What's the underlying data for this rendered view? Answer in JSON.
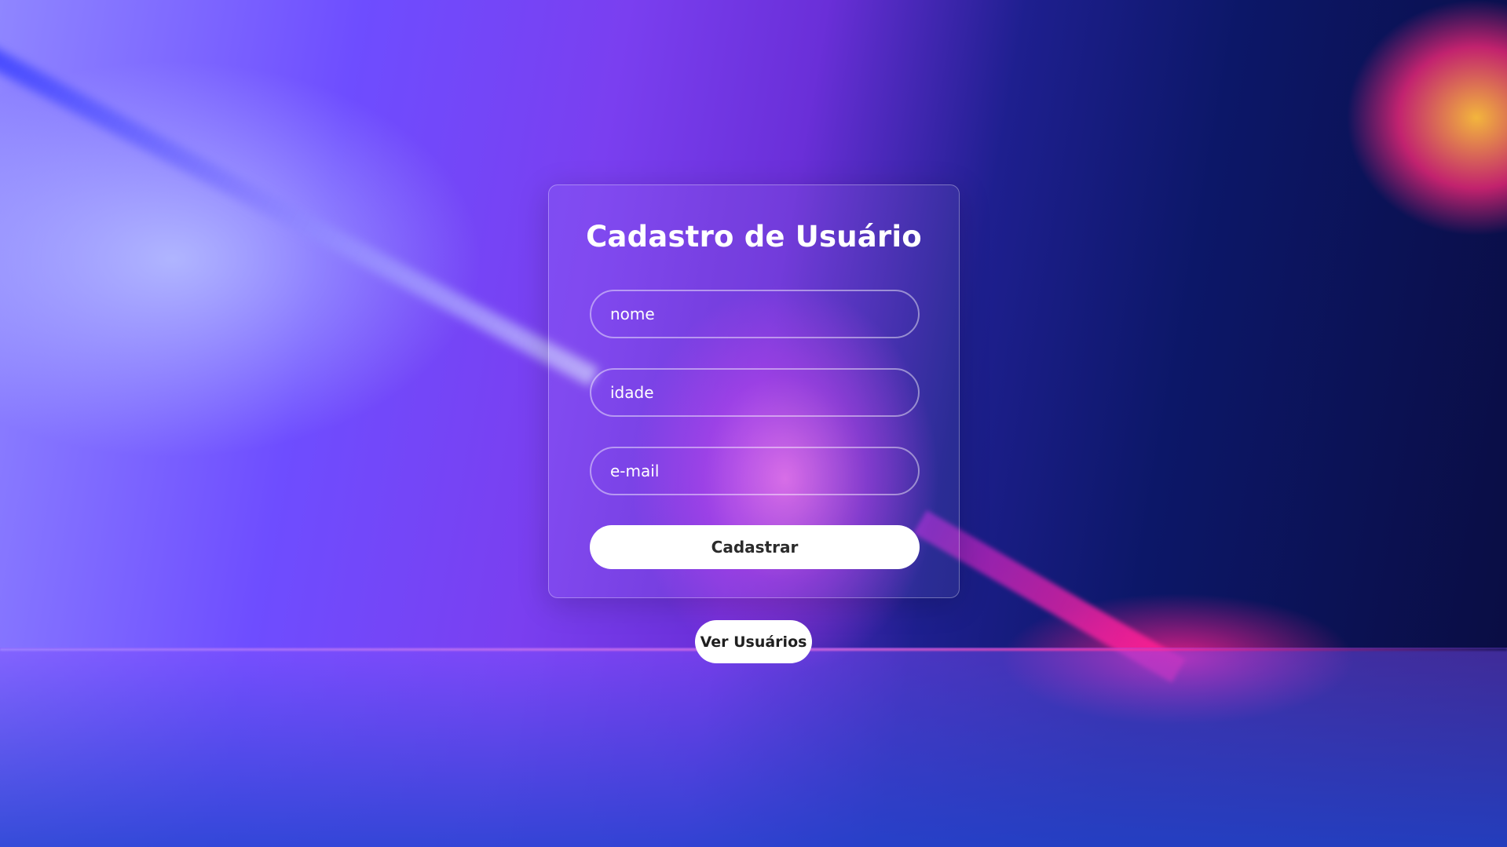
{
  "form": {
    "title": "Cadastro de Usuário",
    "fields": {
      "name_placeholder": "nome",
      "age_placeholder": "idade",
      "email_placeholder": "e-mail"
    },
    "submit_label": "Cadastrar"
  },
  "actions": {
    "view_users_label": "Ver Usuários"
  }
}
